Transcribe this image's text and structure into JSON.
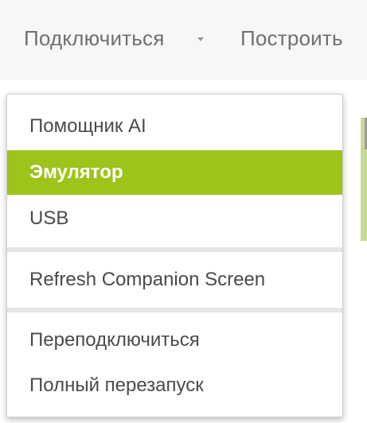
{
  "menubar": {
    "connect_label": "Подключиться",
    "build_label": "Построить"
  },
  "dropdown": {
    "items": [
      {
        "label": "Помощник AI",
        "active": false
      },
      {
        "label": "Эмулятор",
        "active": true
      },
      {
        "label": "USB",
        "active": false
      },
      {
        "label": "Refresh Companion Screen",
        "active": false
      },
      {
        "label": "Переподключиться",
        "active": false
      },
      {
        "label": "Полный перезапуск",
        "active": false
      }
    ]
  },
  "colors": {
    "active_item": "#9dc41a",
    "menubar_bg": "#f7f7f7",
    "text": "#4a4a4a"
  },
  "icons": {
    "connect_caret": "caret-down-icon"
  }
}
